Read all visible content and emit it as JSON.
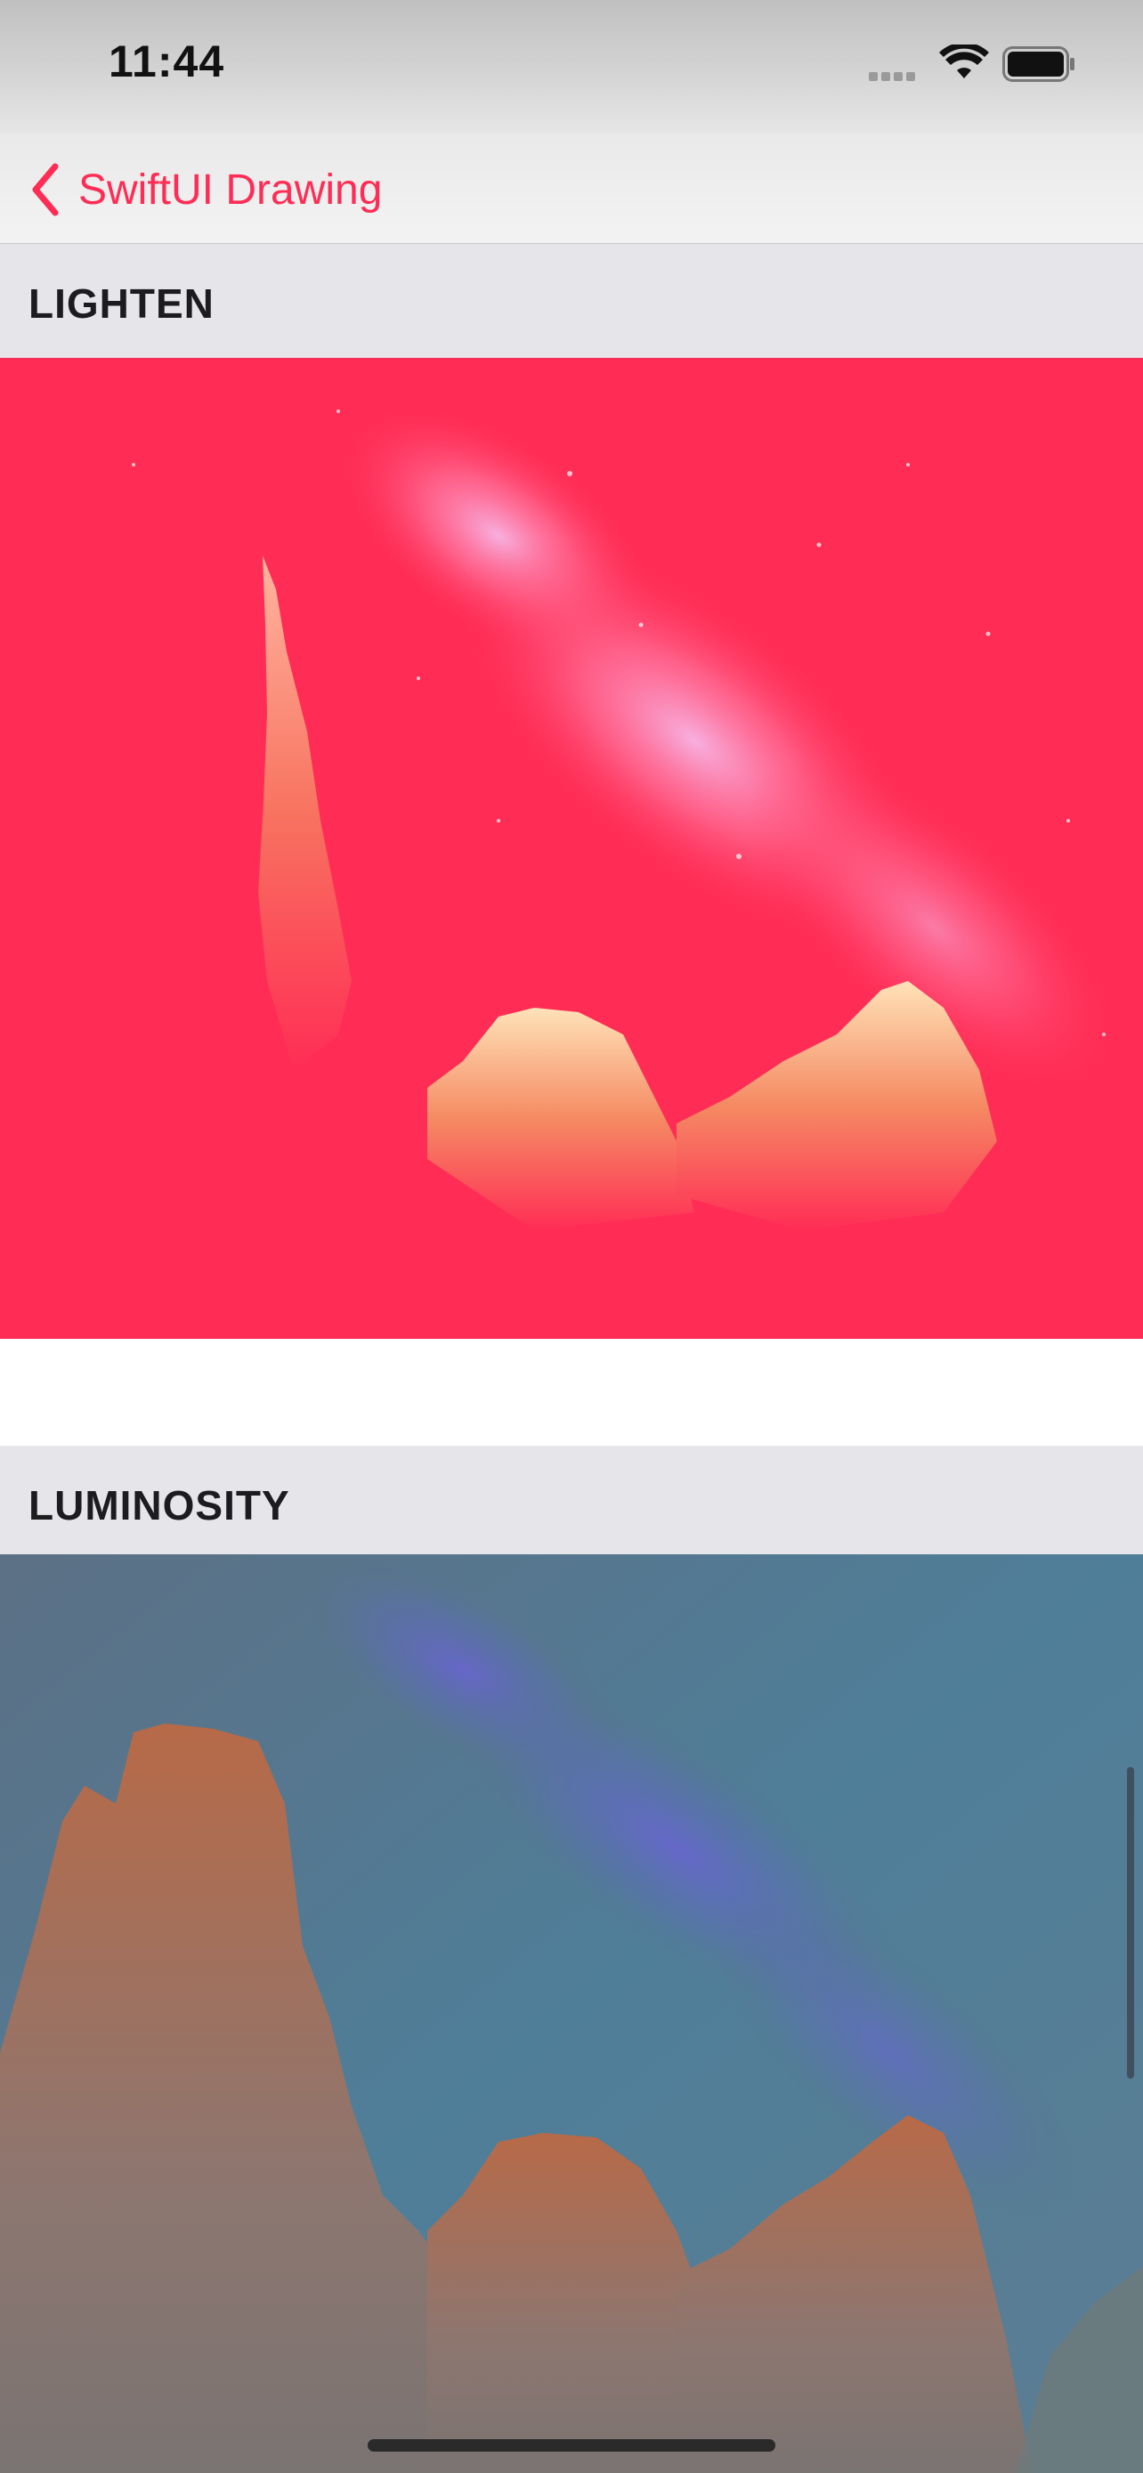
{
  "status_bar": {
    "time": "11:44",
    "icons": [
      "cellular-signal-icon",
      "wifi-icon",
      "battery-icon"
    ]
  },
  "nav": {
    "back_label": "SwiftUI Drawing",
    "back_icon": "chevron-left-icon",
    "accent_color": "#ff2d55"
  },
  "sections": [
    {
      "title": "LIGHTEN",
      "blend_mode": "lighten",
      "tint_color": "#ff2d55"
    },
    {
      "title": "LUMINOSITY",
      "blend_mode": "luminosity",
      "tint_color": "#5a7590"
    }
  ]
}
